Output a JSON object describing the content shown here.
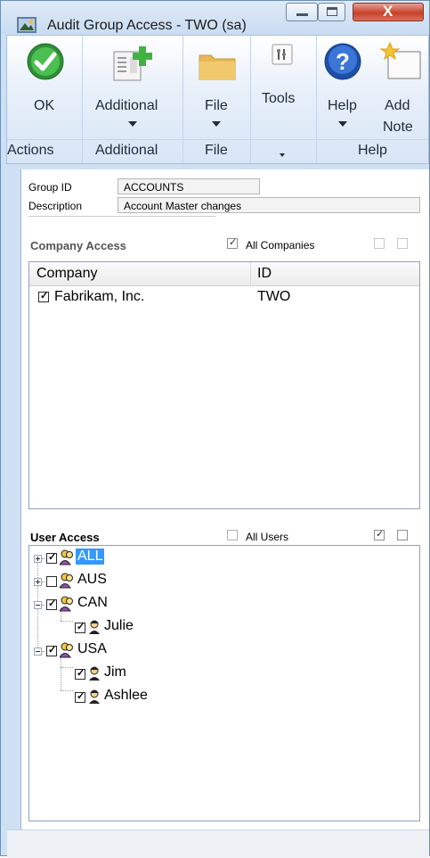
{
  "window": {
    "title": "Audit Group Access  -  TWO (sa)"
  },
  "ribbon": {
    "buttons": {
      "ok": "OK",
      "additional": "Additional",
      "file": "File",
      "tools": "Tools",
      "help": "Help",
      "add_note_line1": "Add",
      "add_note_line2": "Note"
    },
    "groups": {
      "actions": "Actions",
      "additional": "Additional",
      "file": "File",
      "help": "Help"
    }
  },
  "form": {
    "group_id_label": "Group ID",
    "group_id_value": "ACCOUNTS",
    "description_label": "Description",
    "description_value": "Account Master changes"
  },
  "company_access": {
    "title": "Company Access",
    "all_companies_label": "All Companies",
    "all_companies_checked": true,
    "columns": [
      "Company",
      "ID"
    ],
    "rows": [
      {
        "company": "Fabrikam, Inc.",
        "id": "TWO",
        "checked": true
      }
    ]
  },
  "user_access": {
    "title": "User Access",
    "all_users_label": "All Users",
    "all_users_checked": false,
    "tree": [
      {
        "label": "ALL",
        "checked": true,
        "expanded": false,
        "level": 0,
        "selected": true
      },
      {
        "label": "AUS",
        "checked": false,
        "expanded": false,
        "level": 0,
        "selected": false
      },
      {
        "label": "CAN",
        "checked": true,
        "expanded": true,
        "level": 0,
        "selected": false
      },
      {
        "label": "Julie",
        "checked": true,
        "level": 1,
        "selected": false
      },
      {
        "label": "USA",
        "checked": true,
        "expanded": true,
        "level": 0,
        "selected": false
      },
      {
        "label": "Jim",
        "checked": true,
        "level": 1,
        "selected": false
      },
      {
        "label": "Ashlee",
        "checked": true,
        "level": 1,
        "selected": false
      }
    ]
  },
  "colors": {
    "selection": "#3399ff",
    "ok_green": "#3aa241",
    "help_blue": "#2358b4"
  },
  "icons": {
    "ok": "check-circle-icon",
    "additional": "document-add-icon",
    "file": "folder-icon",
    "tools": "tools-icon",
    "help": "help-question-icon",
    "add_note": "note-star-icon",
    "group": "group-users-icon",
    "user": "user-icon"
  }
}
